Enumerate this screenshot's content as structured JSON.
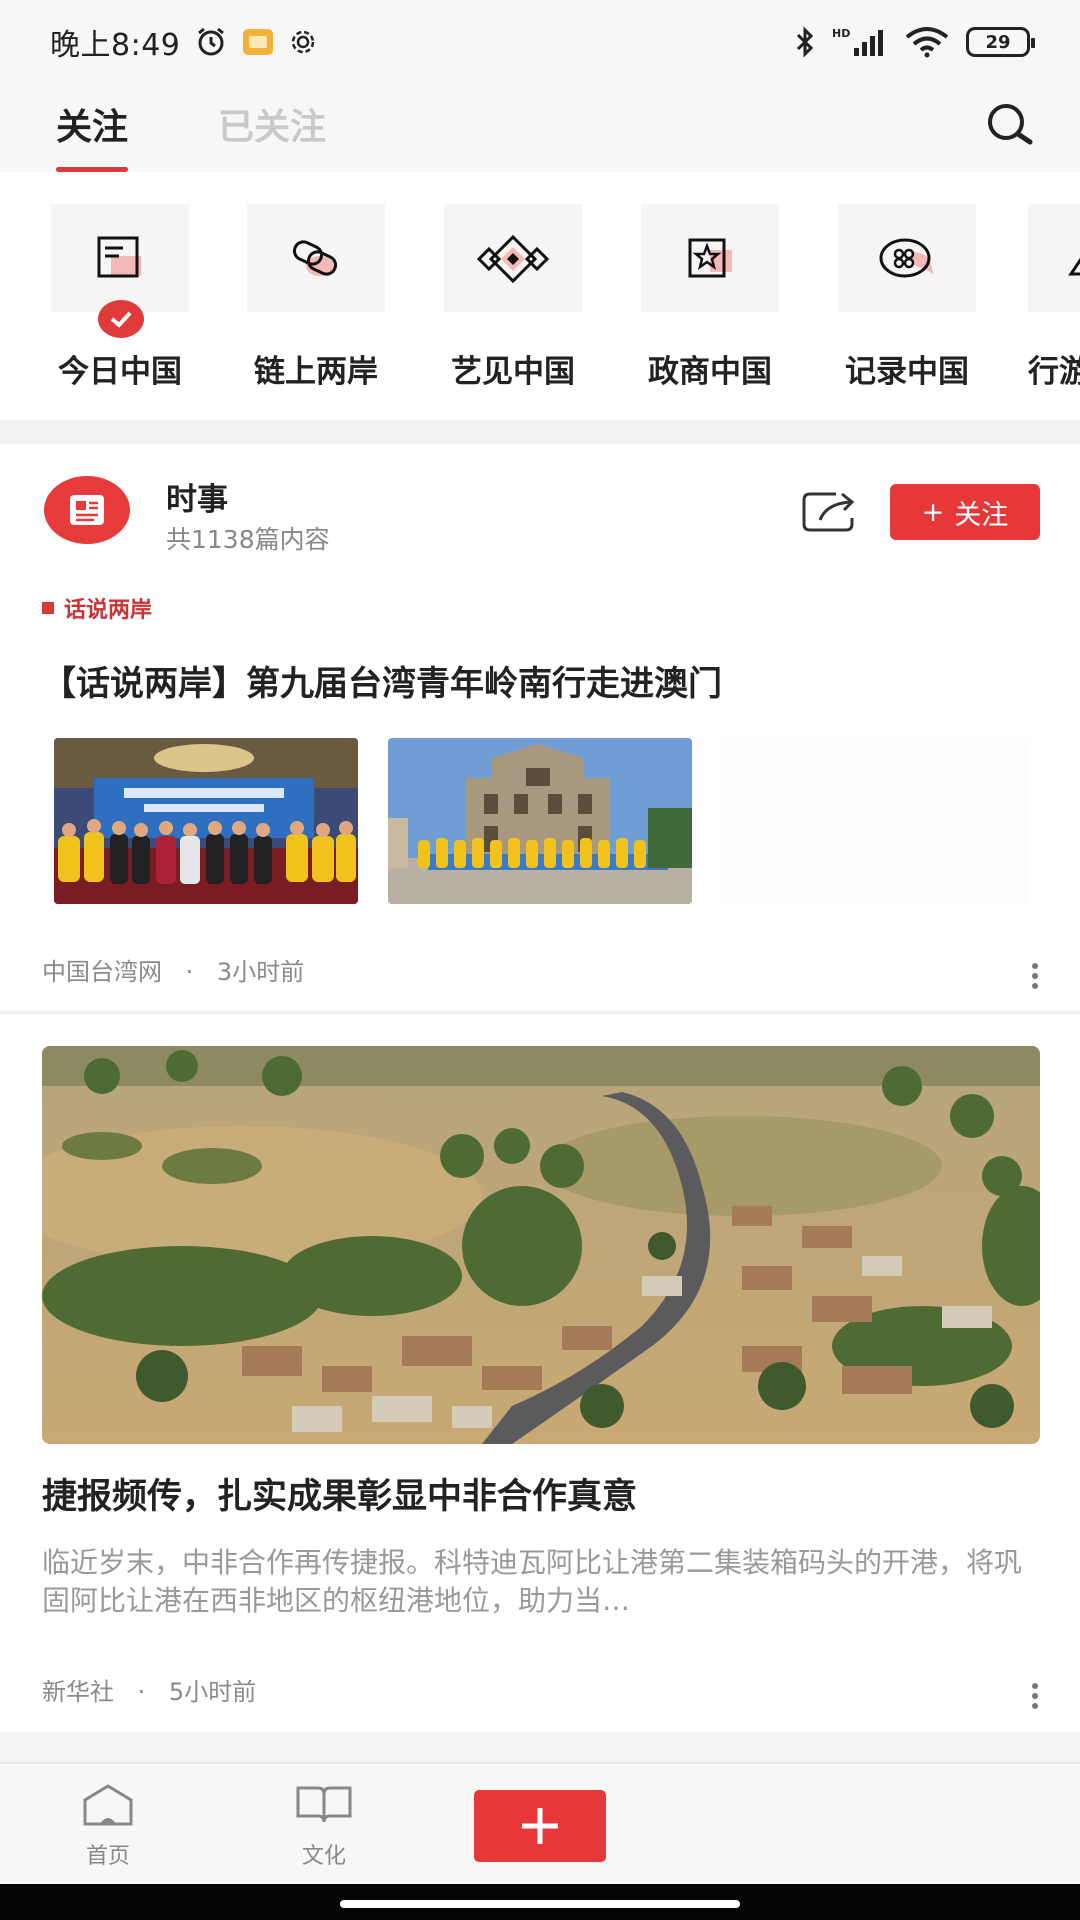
{
  "status_bar": {
    "time": "晚上8:49",
    "battery": "29",
    "network": "HD"
  },
  "top_tabs": {
    "active": "关注",
    "inactive": "已关注"
  },
  "channels": [
    {
      "label": "今日中国",
      "icon": "news-icon",
      "subscribed": true
    },
    {
      "label": "链上两岸",
      "icon": "link-icon",
      "subscribed": false
    },
    {
      "label": "艺见中国",
      "icon": "pattern-icon",
      "subscribed": false
    },
    {
      "label": "政商中国",
      "icon": "star-frame-icon",
      "subscribed": false
    },
    {
      "label": "记录中国",
      "icon": "chat-bubble-icon",
      "subscribed": false
    },
    {
      "label": "行游",
      "icon": "mountain-icon",
      "subscribed": false
    }
  ],
  "topic": {
    "name": "时事",
    "count": "共1138篇内容",
    "follow_label": "关注",
    "follow_plus": "+"
  },
  "article1": {
    "tag": "话说两岸",
    "title": "【话说两岸】第九届台湾青年岭南行走进澳门",
    "source": "中国台湾网",
    "separator": "·",
    "time": "3小时前"
  },
  "article2": {
    "title": "捷报频传，扎实成果彰显中非合作真意",
    "summary": "临近岁末，中非合作再传捷报。科特迪瓦阿比让港第二集装箱码头的开港，将巩固阿比让港在西非地区的枢纽港地位，助力当…",
    "source": "新华社",
    "separator": "·",
    "time": "5小时前"
  },
  "bottom_nav": {
    "home": "首页",
    "culture": "文化"
  },
  "colors": {
    "accent": "#e63838",
    "muted": "#888888"
  }
}
